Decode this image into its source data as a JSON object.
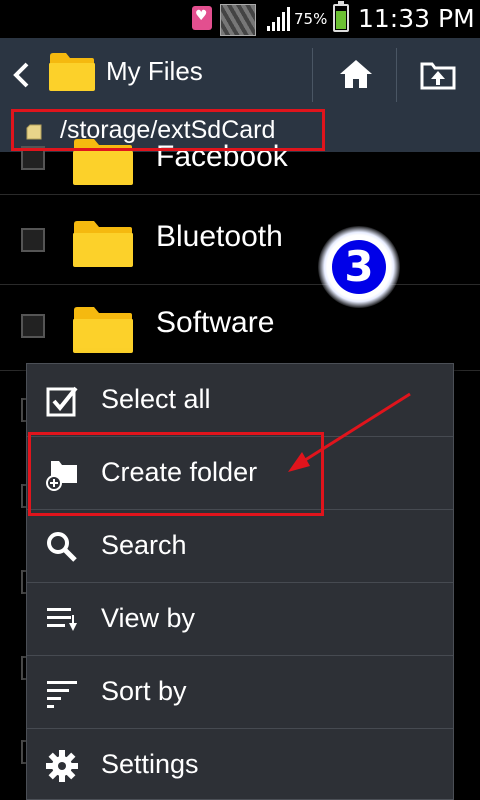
{
  "status_bar": {
    "battery_percent": "75%",
    "battery_level": 0.75,
    "time": "11:33 PM",
    "icons": [
      "notification-heart-icon",
      "gallery-icon",
      "signal-icon",
      "battery-icon"
    ]
  },
  "action_bar": {
    "title": "My Files",
    "icons": [
      "back-icon",
      "folder-icon",
      "home-icon",
      "upload-icon"
    ]
  },
  "path_bar": {
    "path": "/storage/extSdCard",
    "icon": "sd-card-icon"
  },
  "file_list": {
    "items": [
      {
        "name": "Facebook"
      },
      {
        "name": "Bluetooth"
      },
      {
        "name": "Software"
      }
    ]
  },
  "annotations": {
    "step_number": "3",
    "highlight_color": "#e0141c",
    "badge_color": "#0000e8"
  },
  "menu": {
    "items": [
      {
        "label": "Select all",
        "icon": "select-all-icon"
      },
      {
        "label": "Create folder",
        "icon": "create-folder-icon"
      },
      {
        "label": "Search",
        "icon": "search-icon"
      },
      {
        "label": "View by",
        "icon": "view-by-icon"
      },
      {
        "label": "Sort by",
        "icon": "sort-by-icon"
      },
      {
        "label": "Settings",
        "icon": "settings-icon"
      }
    ]
  },
  "colors": {
    "action_bar_bg": "#2b3542",
    "menu_bg": "#2d3036",
    "folder_yellow": "#f8c21c"
  }
}
